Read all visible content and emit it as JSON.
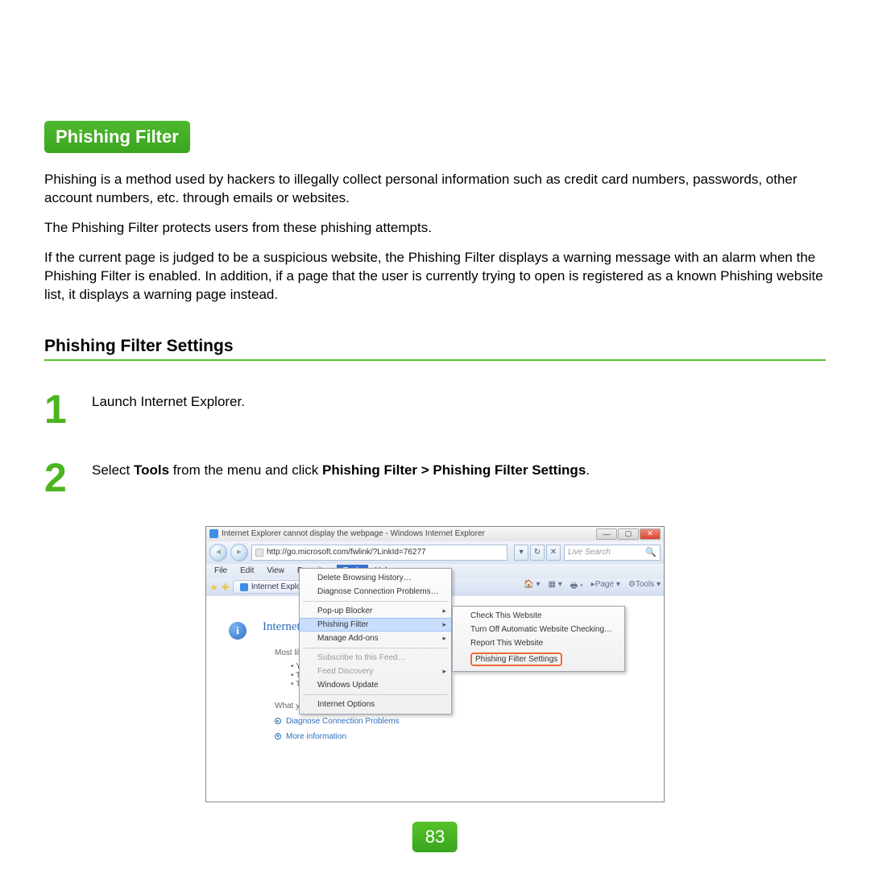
{
  "section_title": "Phishing Filter",
  "paragraphs": {
    "p1": "Phishing is a method used by hackers to illegally collect personal information such as credit card numbers, passwords, other account numbers, etc. through emails or websites.",
    "p2": "The Phishing Filter protects users from these phishing attempts.",
    "p3": "If the current page is judged to be a suspicious website, the Phishing Filter displays a warning message with an alarm when the Phishing Filter is enabled. In addition, if a page that the user is currently trying to open is registered as a known Phishing website list, it displays a warning page instead."
  },
  "subheading": "Phishing Filter Settings",
  "steps": {
    "s1_num": "1",
    "s1_text": "Launch Internet Explorer.",
    "s2_num": "2",
    "s2_pre": "Select ",
    "s2_b1": "Tools",
    "s2_mid": " from the menu and click ",
    "s2_b2": "Phishing Filter > Phishing Filter Settings",
    "s2_end": "."
  },
  "page_number": "83",
  "ie": {
    "title": "Internet Explorer cannot display the webpage - Windows Internet Explorer",
    "url": "http://go.microsoft.com/fwlink/?LinkId=76277",
    "search_placeholder": "Live Search",
    "menubar": [
      "File",
      "Edit",
      "View",
      "Favorites",
      "Tools",
      "Help"
    ],
    "tab_label": "Internet Explore",
    "toolbar_page": "Page",
    "toolbar_tools": "Tools",
    "content_title": "Internet Exp",
    "most_likely": "Most likely caus",
    "bullets": [
      "You are",
      "The webs",
      "There mi"
    ],
    "what_try": "What you can try",
    "link_diag": "Diagnose Connection Problems",
    "link_more": "More information",
    "tools_menu": {
      "delete": "Delete Browsing History…",
      "diag": "Diagnose Connection Problems…",
      "popup": "Pop-up Blocker",
      "phish": "Phishing Filter",
      "addons": "Manage Add-ons",
      "sub_feed": "Subscribe to this Feed…",
      "feed_disc": "Feed Discovery",
      "win_update": "Windows Update",
      "inet_opt": "Internet Options"
    },
    "phish_submenu": {
      "check": "Check This Website",
      "turnoff": "Turn Off Automatic Website Checking…",
      "report": "Report This Website",
      "settings": "Phishing Filter Settings"
    }
  }
}
